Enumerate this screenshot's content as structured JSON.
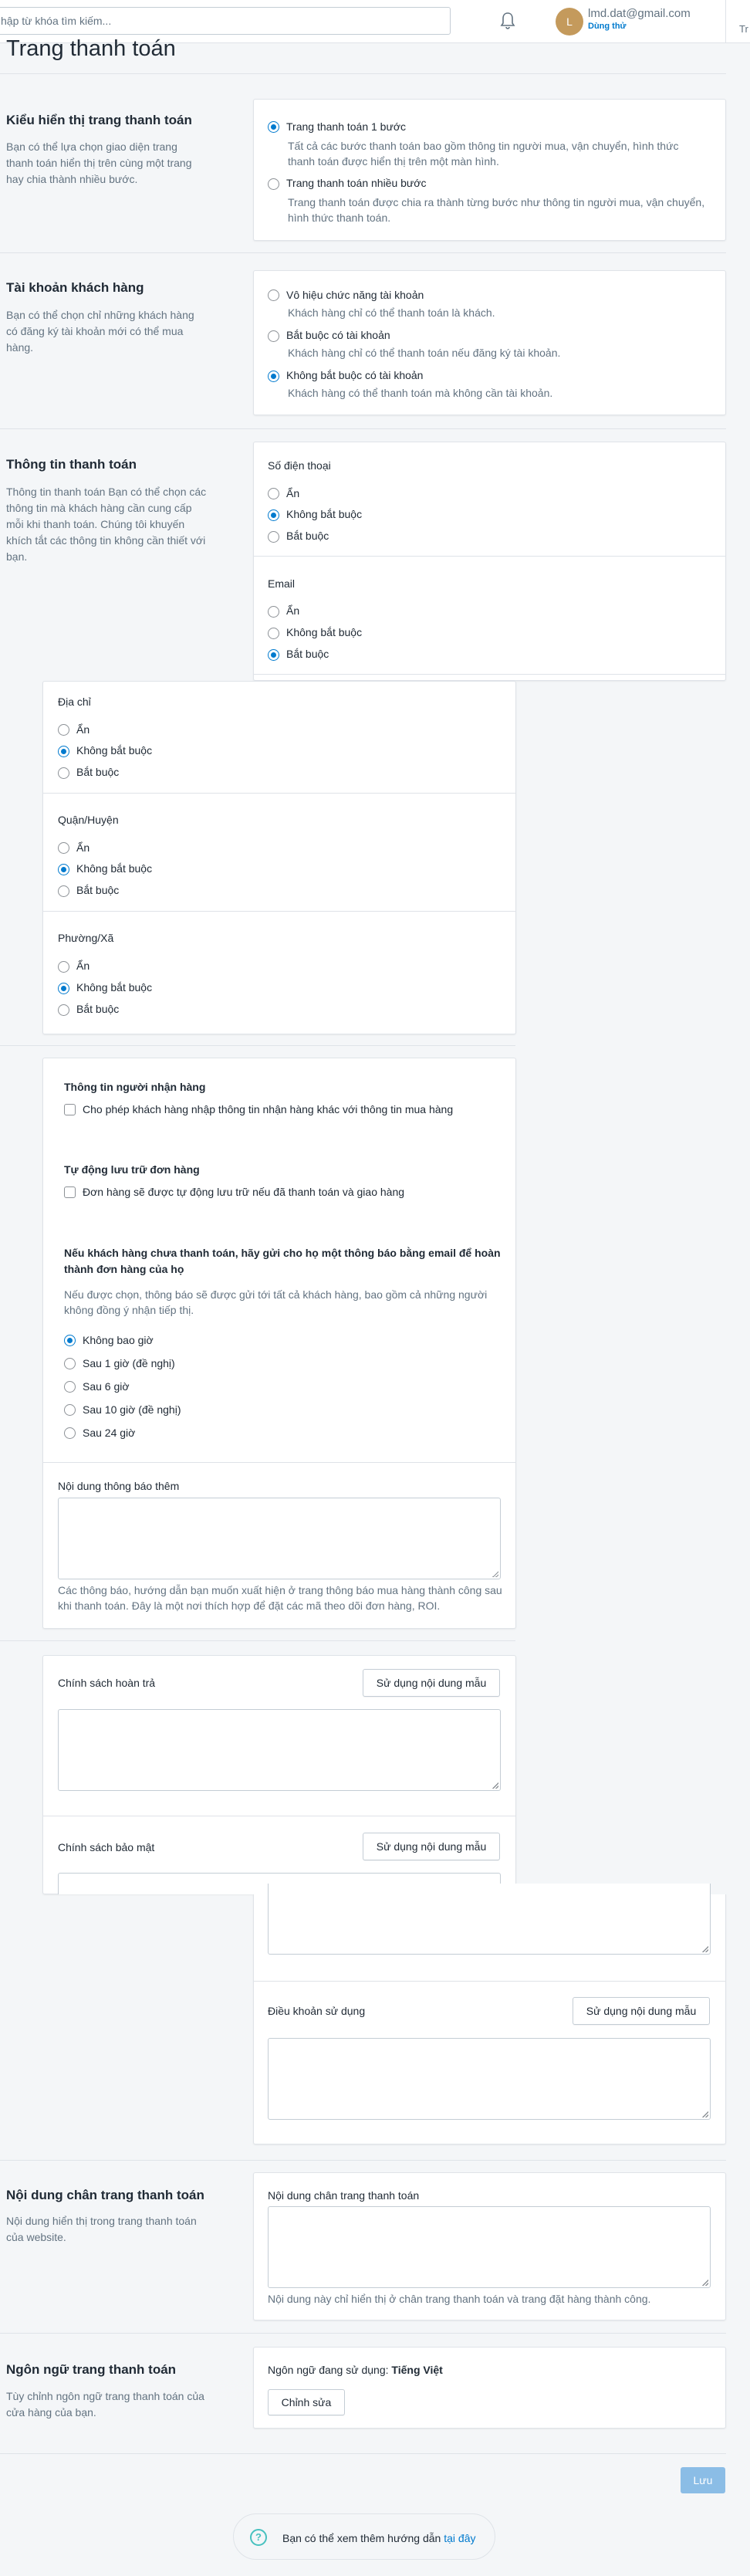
{
  "header": {
    "search_placeholder": "hập từ khóa tìm kiếm...",
    "avatar_letter": "L",
    "account_email": "lmd.dat@gmail.com",
    "account_status": "Dùng thử",
    "right_truncated": "Tr"
  },
  "page": {
    "title": "Trang thanh toán"
  },
  "checkout_style": {
    "title": "Kiểu hiển thị trang thanh toán",
    "desc": "Bạn có thể lựa chọn giao diện trang thanh toán hiển thị trên cùng một trang hay chia thành nhiều bước.",
    "options": [
      {
        "label": "Trang thanh toán 1 bước",
        "hint": "Tất cả các bước thanh toán bao gồm thông tin người mua, vận chuyển, hình thức thanh toán được hiển thị trên một màn hình."
      },
      {
        "label": "Trang thanh toán nhiều bước",
        "hint": "Trang thanh toán được chia ra thành từng bước như thông tin người mua, vận chuyển, hình thức thanh toán."
      }
    ]
  },
  "customer_accounts": {
    "title": "Tài khoản khách hàng",
    "desc": "Bạn có thể chọn chỉ những khách hàng có đăng ký tài khoản mới có thể mua hàng.",
    "options": [
      {
        "label": "Vô hiệu chức năng tài khoản",
        "hint": "Khách hàng chỉ có thể thanh toán là khách."
      },
      {
        "label": "Bắt buộc có tài khoản",
        "hint": "Khách hàng chỉ có thể thanh toán nếu đăng ký tài khoản."
      },
      {
        "label": "Không bắt buộc có tài khoản",
        "hint": "Khách hàng có thể thanh toán mà không cần tài khoản."
      }
    ]
  },
  "checkout_info": {
    "title": "Thông tin thanh toán",
    "desc": "Thông tin thanh toán Bạn có thể chọn các thông tin mà khách hàng cần cung cấp mỗi khi thanh toán. Chúng tôi khuyến khích tắt các thông tin không cần thiết với bạn.",
    "option_labels": {
      "hidden": "Ẩn",
      "optional": "Không bắt buộc",
      "required": "Bắt buộc"
    },
    "fields": [
      {
        "name": "Số điện thoại",
        "selected": "optional"
      },
      {
        "name": "Email",
        "selected": "required"
      },
      {
        "name": "Địa chỉ",
        "selected": "optional"
      },
      {
        "name": "Quận/Huyện",
        "selected": "optional"
      },
      {
        "name": "Phường/Xã",
        "selected": "optional"
      }
    ]
  },
  "order_processing": {
    "recipient_title": "Thông tin người nhận hàng",
    "recipient_check": "Cho phép khách hàng nhập thông tin nhận hàng khác với thông tin mua hàng",
    "archive_title": "Tự động lưu trữ đơn hàng",
    "archive_check": "Đơn hàng sẽ được tự động lưu trữ nếu đã thanh toán và giao hàng",
    "abandoned_title": "Nếu khách hàng chưa thanh toán, hãy gửi cho họ một thông báo bằng email để hoàn thành đơn hàng của họ",
    "abandoned_desc": "Nếu được chọn, thông báo sẽ được gửi tới tất cả khách hàng, bao gồm cả những người không đồng ý nhận tiếp thị.",
    "abandoned_options": [
      "Không bao giờ",
      "Sau 1 giờ (đề nghị)",
      "Sau 6 giờ",
      "Sau 10 giờ (đề nghị)",
      "Sau 24 giờ"
    ],
    "additional_label": "Nội dung thông báo thêm",
    "additional_hint": "Các thông báo, hướng dẫn bạn muốn xuất hiện ở trang thông báo mua hàng thành công sau khi thanh toán. Đây là một nơi thích hợp để đặt các mã theo dõi đơn hàng, ROI."
  },
  "policies": {
    "use_template": "Sử dụng nội dung mẫu",
    "refund": "Chính sách hoàn trả",
    "privacy": "Chính sách bảo mật",
    "terms": "Điều khoản sử dụng"
  },
  "footer_content": {
    "title": "Nội dung chân trang thanh toán",
    "desc": "Nội dung hiển thị trong trang thanh toán của website.",
    "field_label": "Nội dung chân trang thanh toán",
    "hint": "Nội dung này chỉ hiển thị ở chân trang thanh toán và trang đặt hàng thành công."
  },
  "language": {
    "title": "Ngôn ngữ trang thanh toán",
    "desc": "Tùy chỉnh ngôn ngữ trang thanh toán của cửa hàng của bạn.",
    "current_prefix": "Ngôn ngữ đang sử dụng:",
    "current_value": "Tiếng Việt",
    "edit": "Chỉnh sửa"
  },
  "actions": {
    "save": "Lưu"
  },
  "help": {
    "text": "Bạn có thể xem thêm hướng dẫn",
    "link": "tại đây",
    "icon": "?"
  },
  "colors": {
    "accent": "#007ace",
    "save_disabled": "#8bbde6",
    "help_icon": "#47c1bf"
  }
}
